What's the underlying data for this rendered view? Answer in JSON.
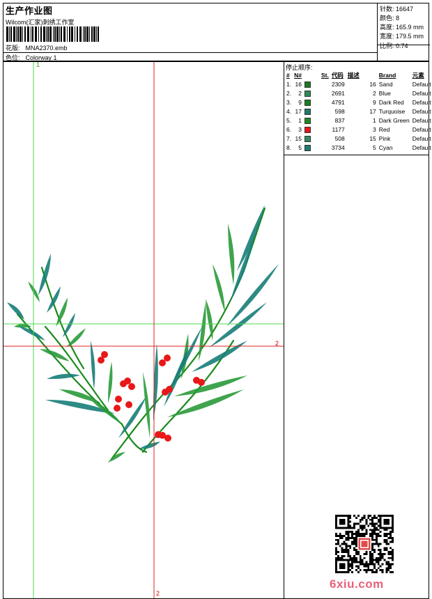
{
  "header": {
    "title": "生产作业图",
    "studio": "Wilcom(汇家)刺绣工作室",
    "design_label": "花版:",
    "design_value": "MNA2370.emb",
    "colorway_label": "色位:",
    "colorway_value": "Colorway 1"
  },
  "stats": [
    {
      "label": "针数:",
      "value": "16647"
    },
    {
      "label": "颜色:",
      "value": "8"
    },
    {
      "label": "高度:",
      "value": "165.9 mm"
    },
    {
      "label": "宽度:",
      "value": "179.5 mm"
    },
    {
      "label": "比例:",
      "value": "0.74"
    }
  ],
  "stop_sequence": {
    "title": "停止顺序:",
    "headers": [
      "#",
      "N#",
      "St.",
      "代码",
      "描述",
      "Brand",
      "元素"
    ],
    "rows": [
      {
        "idx": "1.",
        "n": "16",
        "color": "#1b7a22",
        "st": "2309",
        "code": "16",
        "desc": "Sand",
        "brand": "Default"
      },
      {
        "idx": "2.",
        "n": "2",
        "color": "#2e8a57",
        "st": "2691",
        "code": "2",
        "desc": "Blue",
        "brand": "Default"
      },
      {
        "idx": "3.",
        "n": "9",
        "color": "#18801c",
        "st": "4791",
        "code": "9",
        "desc": "Dark Red",
        "brand": "Default"
      },
      {
        "idx": "4.",
        "n": "17",
        "color": "#1f7a6c",
        "st": "598",
        "code": "17",
        "desc": "Turquoise",
        "brand": "Default"
      },
      {
        "idx": "5.",
        "n": "1",
        "color": "#1d8a1d",
        "st": "837",
        "code": "1",
        "desc": "Dark Green",
        "brand": "Default"
      },
      {
        "idx": "6.",
        "n": "3",
        "color": "#e8161b",
        "st": "1177",
        "code": "3",
        "desc": "Red",
        "brand": "Default"
      },
      {
        "idx": "7.",
        "n": "15",
        "color": "#2f8c62",
        "st": "508",
        "code": "15",
        "desc": "Pink",
        "brand": "Default"
      },
      {
        "idx": "8.",
        "n": "5",
        "color": "#1e7a74",
        "st": "3734",
        "code": "5",
        "desc": "Cyan",
        "brand": "Default"
      }
    ]
  },
  "markers": {
    "top_1": "1",
    "right_2": "2",
    "bottom_2": "2"
  },
  "colors": {
    "green_line": "#4cd84c",
    "red_line": "#e02020",
    "leaf_teal": "#177d78",
    "leaf_green": "#2a9a3a",
    "stem": "#1a8a1a",
    "flower": "#e81818"
  },
  "watermark": "6xiu.com"
}
